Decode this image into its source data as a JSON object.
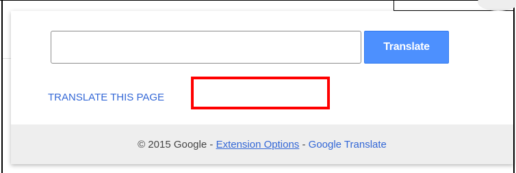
{
  "popup": {
    "input": {
      "value": "",
      "placeholder": ""
    },
    "translate_button_label": "Translate",
    "translate_page_link": "TRANSLATE THIS PAGE",
    "footer": {
      "copyright": "© 2015 Google",
      "separator_1": " - ",
      "extension_options_link": "Extension Options",
      "separator_2": " - ",
      "google_translate_link": "Google Translate"
    }
  },
  "colors": {
    "button_bg": "#4d90fe",
    "link": "#3367d6",
    "footer_bg": "#eeeeee",
    "highlight": "#ff0000"
  }
}
